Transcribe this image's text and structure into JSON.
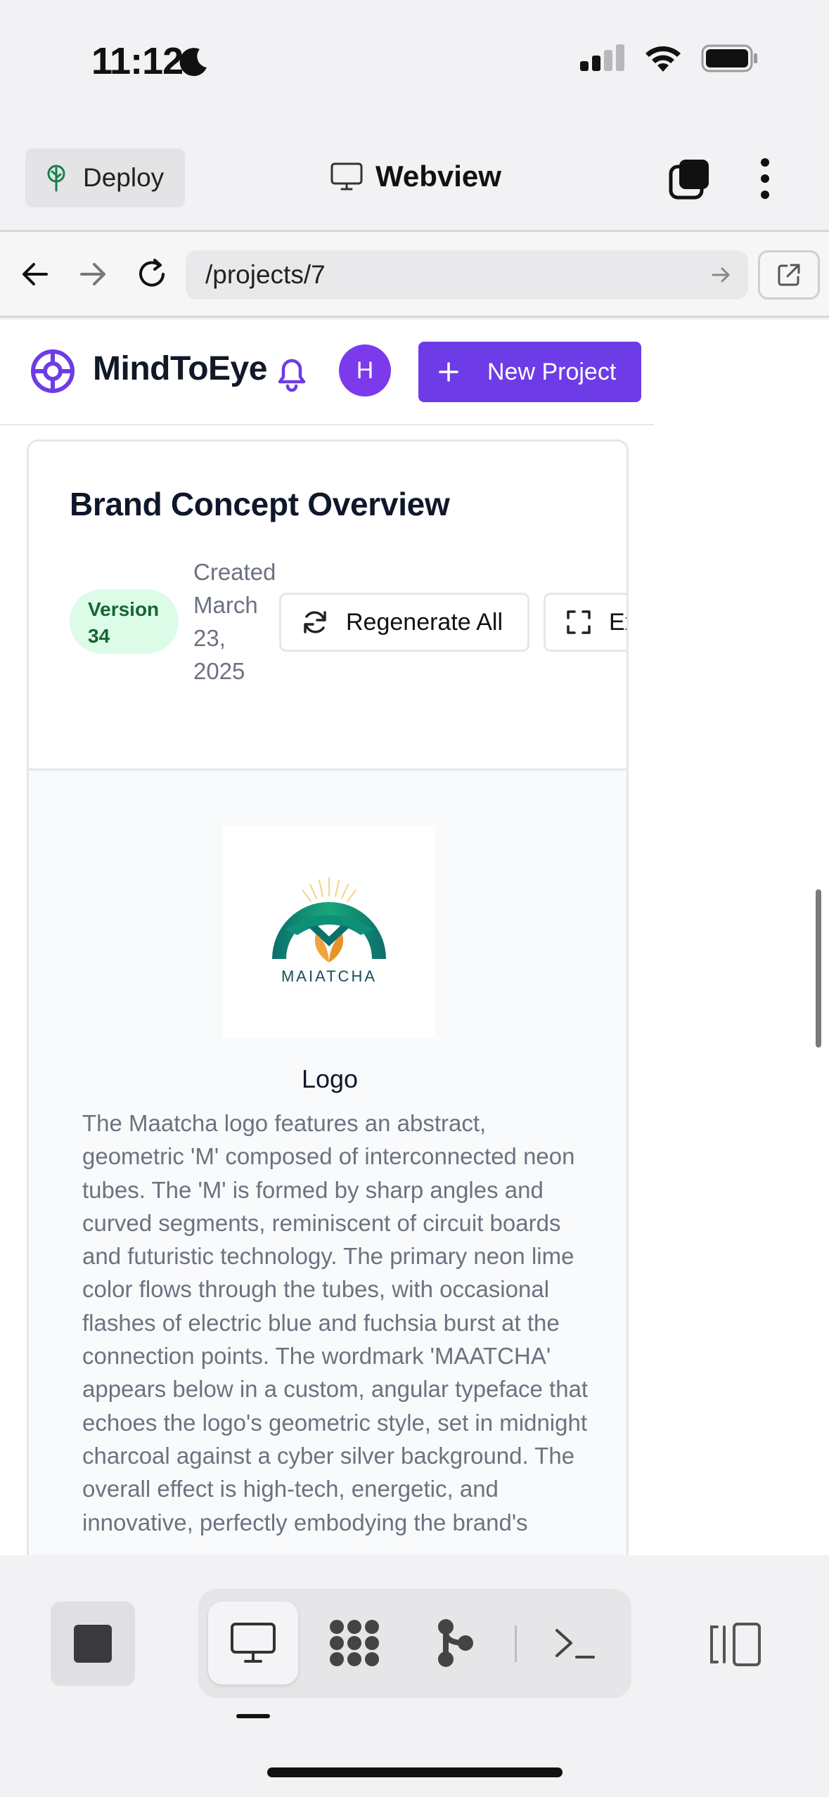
{
  "status_bar": {
    "time": "11:12"
  },
  "top_bar": {
    "deploy_label": "Deploy",
    "title": "Webview"
  },
  "address_bar": {
    "url": "/projects/7"
  },
  "site": {
    "brand_name": "MindToEye",
    "avatar_initial": "H",
    "new_project_label": "New Project",
    "accent_color": "#6d3ce6"
  },
  "card": {
    "title": "Brand Concept Overview",
    "version_line1": "Version",
    "version_line2": "34",
    "created_lines": [
      "Created",
      "March",
      "23,",
      "2025"
    ],
    "regenerate_label": "Regenerate All",
    "export_label": "Export",
    "asset": {
      "logo_wordmark": "MAIATCHA",
      "title": "Logo",
      "description": "The Maatcha logo features an abstract, geometric 'M' composed of interconnected neon tubes. The 'M' is formed by sharp angles and curved segments, reminiscent of circuit boards and futuristic technology. The primary neon lime color flows through the tubes, with occasional flashes of electric blue and fuchsia burst at the connection points. The wordmark 'MAATCHA' appears below in a custom, angular typeface that echoes the logo's geometric style, set in midnight charcoal against a cyber silver background. The overall effect is high-tech, energetic, and innovative, perfectly embodying the brand's"
    }
  },
  "bottom_bar": {
    "tools": [
      "webview-tool",
      "apps-tool",
      "git-tool",
      "terminal-tool"
    ],
    "active_tool": "webview-tool"
  }
}
